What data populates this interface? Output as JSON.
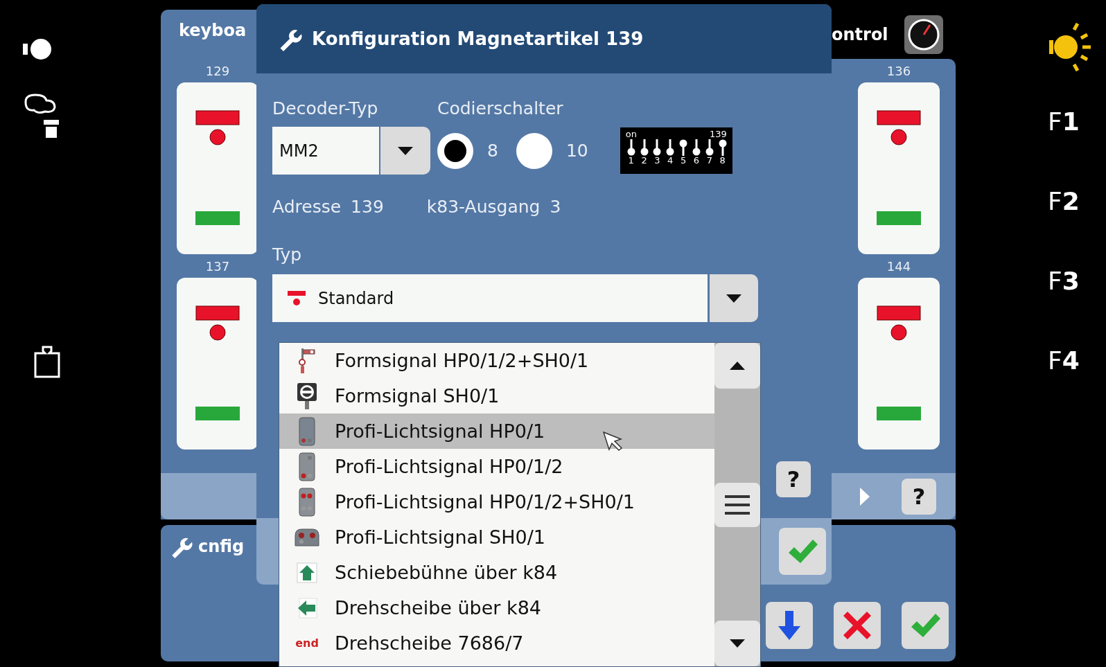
{
  "keyboard_panel": {
    "title": "keyboa",
    "left_cards": [
      {
        "number": "129"
      },
      {
        "number": "137"
      }
    ],
    "right_cards": [
      {
        "number": "136"
      },
      {
        "number": "144"
      }
    ],
    "help": "?"
  },
  "control_tab": {
    "label": "ontrol"
  },
  "config_panel": {
    "title": "cnfig"
  },
  "dialog": {
    "title": "Konfiguration Magnetartikel 139",
    "decoder_label": "Decoder-Typ",
    "decoder_value": "MM2",
    "switch_label": "Codierschalter",
    "switch_options": [
      {
        "label": "8",
        "selected": true
      },
      {
        "label": "10",
        "selected": false
      }
    ],
    "dip": {
      "on_label": "on",
      "value": "139",
      "switches": [
        {
          "label": "1",
          "on": false
        },
        {
          "label": "2",
          "on": false
        },
        {
          "label": "3",
          "on": false
        },
        {
          "label": "4",
          "on": false
        },
        {
          "label": "5",
          "on": true
        },
        {
          "label": "6",
          "on": false
        },
        {
          "label": "7",
          "on": false
        },
        {
          "label": "8",
          "on": true
        }
      ]
    },
    "address_label": "Adresse",
    "address": "139",
    "output_label": "k83-Ausgang",
    "output": "3",
    "type_label": "Typ",
    "type_value": "Standard",
    "help": "?"
  },
  "type_list": {
    "items": [
      {
        "kind": "form-hp",
        "label": "Formsignal HP0/1/2+SH0/1",
        "selected": false
      },
      {
        "kind": "form-sh",
        "label": "Formsignal SH0/1",
        "selected": false
      },
      {
        "kind": "light-hp",
        "label": "Profi-Lichtsignal HP0/1",
        "selected": true
      },
      {
        "kind": "light-hp2",
        "label": "Profi-Lichtsignal HP0/1/2",
        "selected": false
      },
      {
        "kind": "light-hpsh",
        "label": "Profi-Lichtsignal HP0/1/2+SH0/1",
        "selected": false
      },
      {
        "kind": "light-sh",
        "label": "Profi-Lichtsignal SH0/1",
        "selected": false
      },
      {
        "kind": "transfer",
        "label": "Schiebebühne über k84",
        "selected": false
      },
      {
        "kind": "turntable",
        "label": "Drehscheibe über k84",
        "selected": false
      },
      {
        "kind": "end",
        "tag": "end",
        "label": "Drehscheibe 7686/7",
        "selected": false
      }
    ]
  },
  "function_keys": [
    {
      "label": "F1"
    },
    {
      "label": "F2"
    },
    {
      "label": "F3"
    },
    {
      "label": "F4"
    }
  ]
}
